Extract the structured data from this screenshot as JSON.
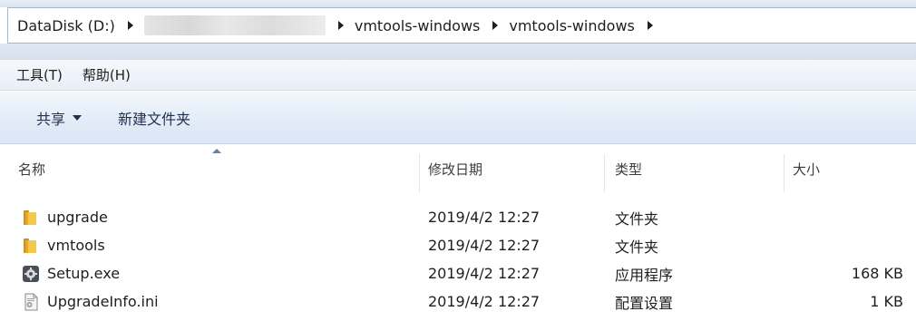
{
  "address": {
    "root": "DataDisk (D:)",
    "segments": [
      "vmtools-windows",
      "vmtools-windows"
    ]
  },
  "menu": {
    "tools": "工具(T)",
    "help": "帮助(H)"
  },
  "toolbar": {
    "share": "共享",
    "new_folder": "新建文件夹"
  },
  "columns": {
    "name": "名称",
    "modified": "修改日期",
    "type": "类型",
    "size": "大小"
  },
  "files": [
    {
      "name": "upgrade",
      "modified": "2019/4/2 12:27",
      "type": "文件夹",
      "size": "",
      "icon": "folder-icon"
    },
    {
      "name": "vmtools",
      "modified": "2019/4/2 12:27",
      "type": "文件夹",
      "size": "",
      "icon": "folder-icon"
    },
    {
      "name": "Setup.exe",
      "modified": "2019/4/2 12:27",
      "type": "应用程序",
      "size": "168 KB",
      "icon": "gear-app-icon"
    },
    {
      "name": "UpgradeInfo.ini",
      "modified": "2019/4/2 12:27",
      "type": "配置设置",
      "size": "1 KB",
      "icon": "settings-file-icon"
    }
  ],
  "colors": {
    "toolbar_text": "#1e3050",
    "folder": "#e8b63a"
  }
}
